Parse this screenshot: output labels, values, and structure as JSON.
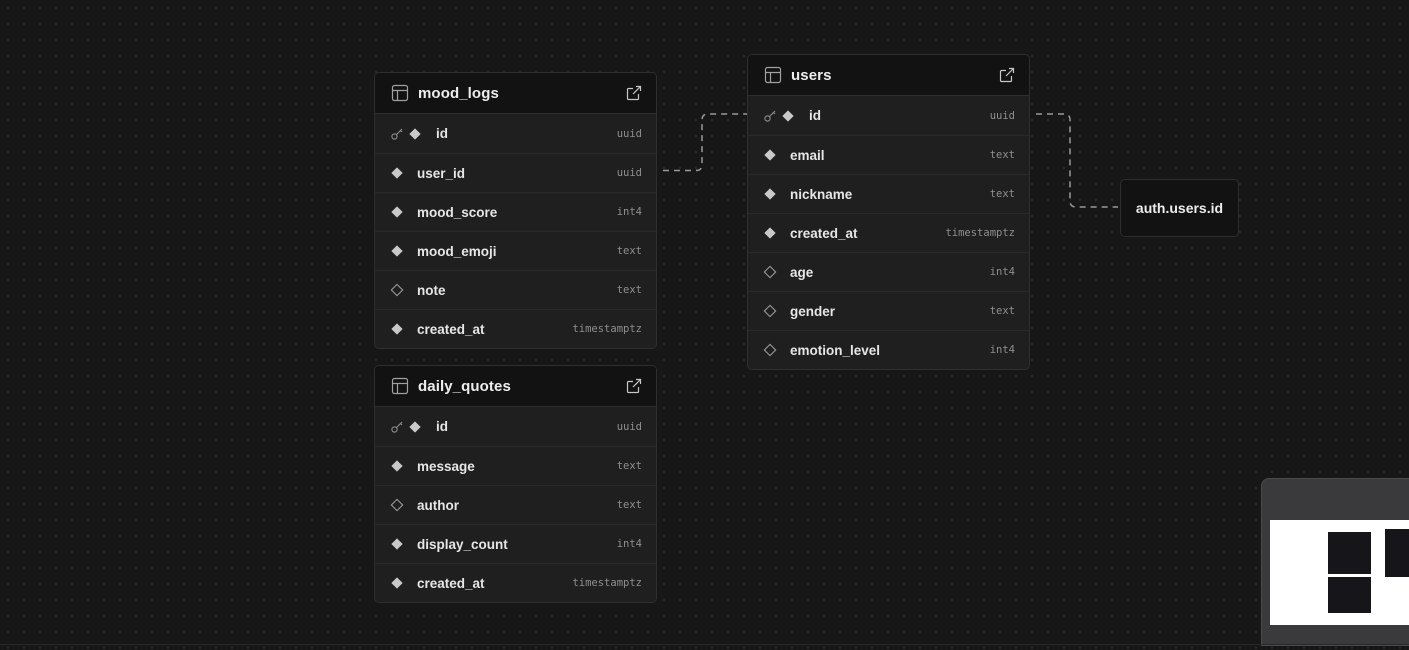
{
  "tables": {
    "mood_logs": {
      "name": "mood_logs",
      "columns": [
        {
          "name": "id",
          "type": "uuid",
          "pk": true,
          "nullable": false
        },
        {
          "name": "user_id",
          "type": "uuid",
          "pk": false,
          "nullable": false
        },
        {
          "name": "mood_score",
          "type": "int4",
          "pk": false,
          "nullable": false
        },
        {
          "name": "mood_emoji",
          "type": "text",
          "pk": false,
          "nullable": false
        },
        {
          "name": "note",
          "type": "text",
          "pk": false,
          "nullable": true
        },
        {
          "name": "created_at",
          "type": "timestamptz",
          "pk": false,
          "nullable": false
        }
      ]
    },
    "daily_quotes": {
      "name": "daily_quotes",
      "columns": [
        {
          "name": "id",
          "type": "uuid",
          "pk": true,
          "nullable": false
        },
        {
          "name": "message",
          "type": "text",
          "pk": false,
          "nullable": false
        },
        {
          "name": "author",
          "type": "text",
          "pk": false,
          "nullable": true
        },
        {
          "name": "display_count",
          "type": "int4",
          "pk": false,
          "nullable": false
        },
        {
          "name": "created_at",
          "type": "timestamptz",
          "pk": false,
          "nullable": false
        }
      ]
    },
    "users": {
      "name": "users",
      "columns": [
        {
          "name": "id",
          "type": "uuid",
          "pk": true,
          "nullable": false
        },
        {
          "name": "email",
          "type": "text",
          "pk": false,
          "nullable": false
        },
        {
          "name": "nickname",
          "type": "text",
          "pk": false,
          "nullable": false
        },
        {
          "name": "created_at",
          "type": "timestamptz",
          "pk": false,
          "nullable": false
        },
        {
          "name": "age",
          "type": "int4",
          "pk": false,
          "nullable": true
        },
        {
          "name": "gender",
          "type": "text",
          "pk": false,
          "nullable": true
        },
        {
          "name": "emotion_level",
          "type": "int4",
          "pk": false,
          "nullable": true
        }
      ]
    }
  },
  "external_ref": {
    "label": "auth.users.id"
  },
  "icons": {
    "table": "table-icon",
    "open": "external-link-icon",
    "primary_key": "key-icon",
    "not_null": "filled-diamond-icon",
    "nullable": "outline-diamond-icon"
  },
  "colors": {
    "canvas": "#171717",
    "node": "#1f1f1f",
    "header": "#121212",
    "border": "#2e2e2e",
    "link": "#9a9a9a"
  }
}
